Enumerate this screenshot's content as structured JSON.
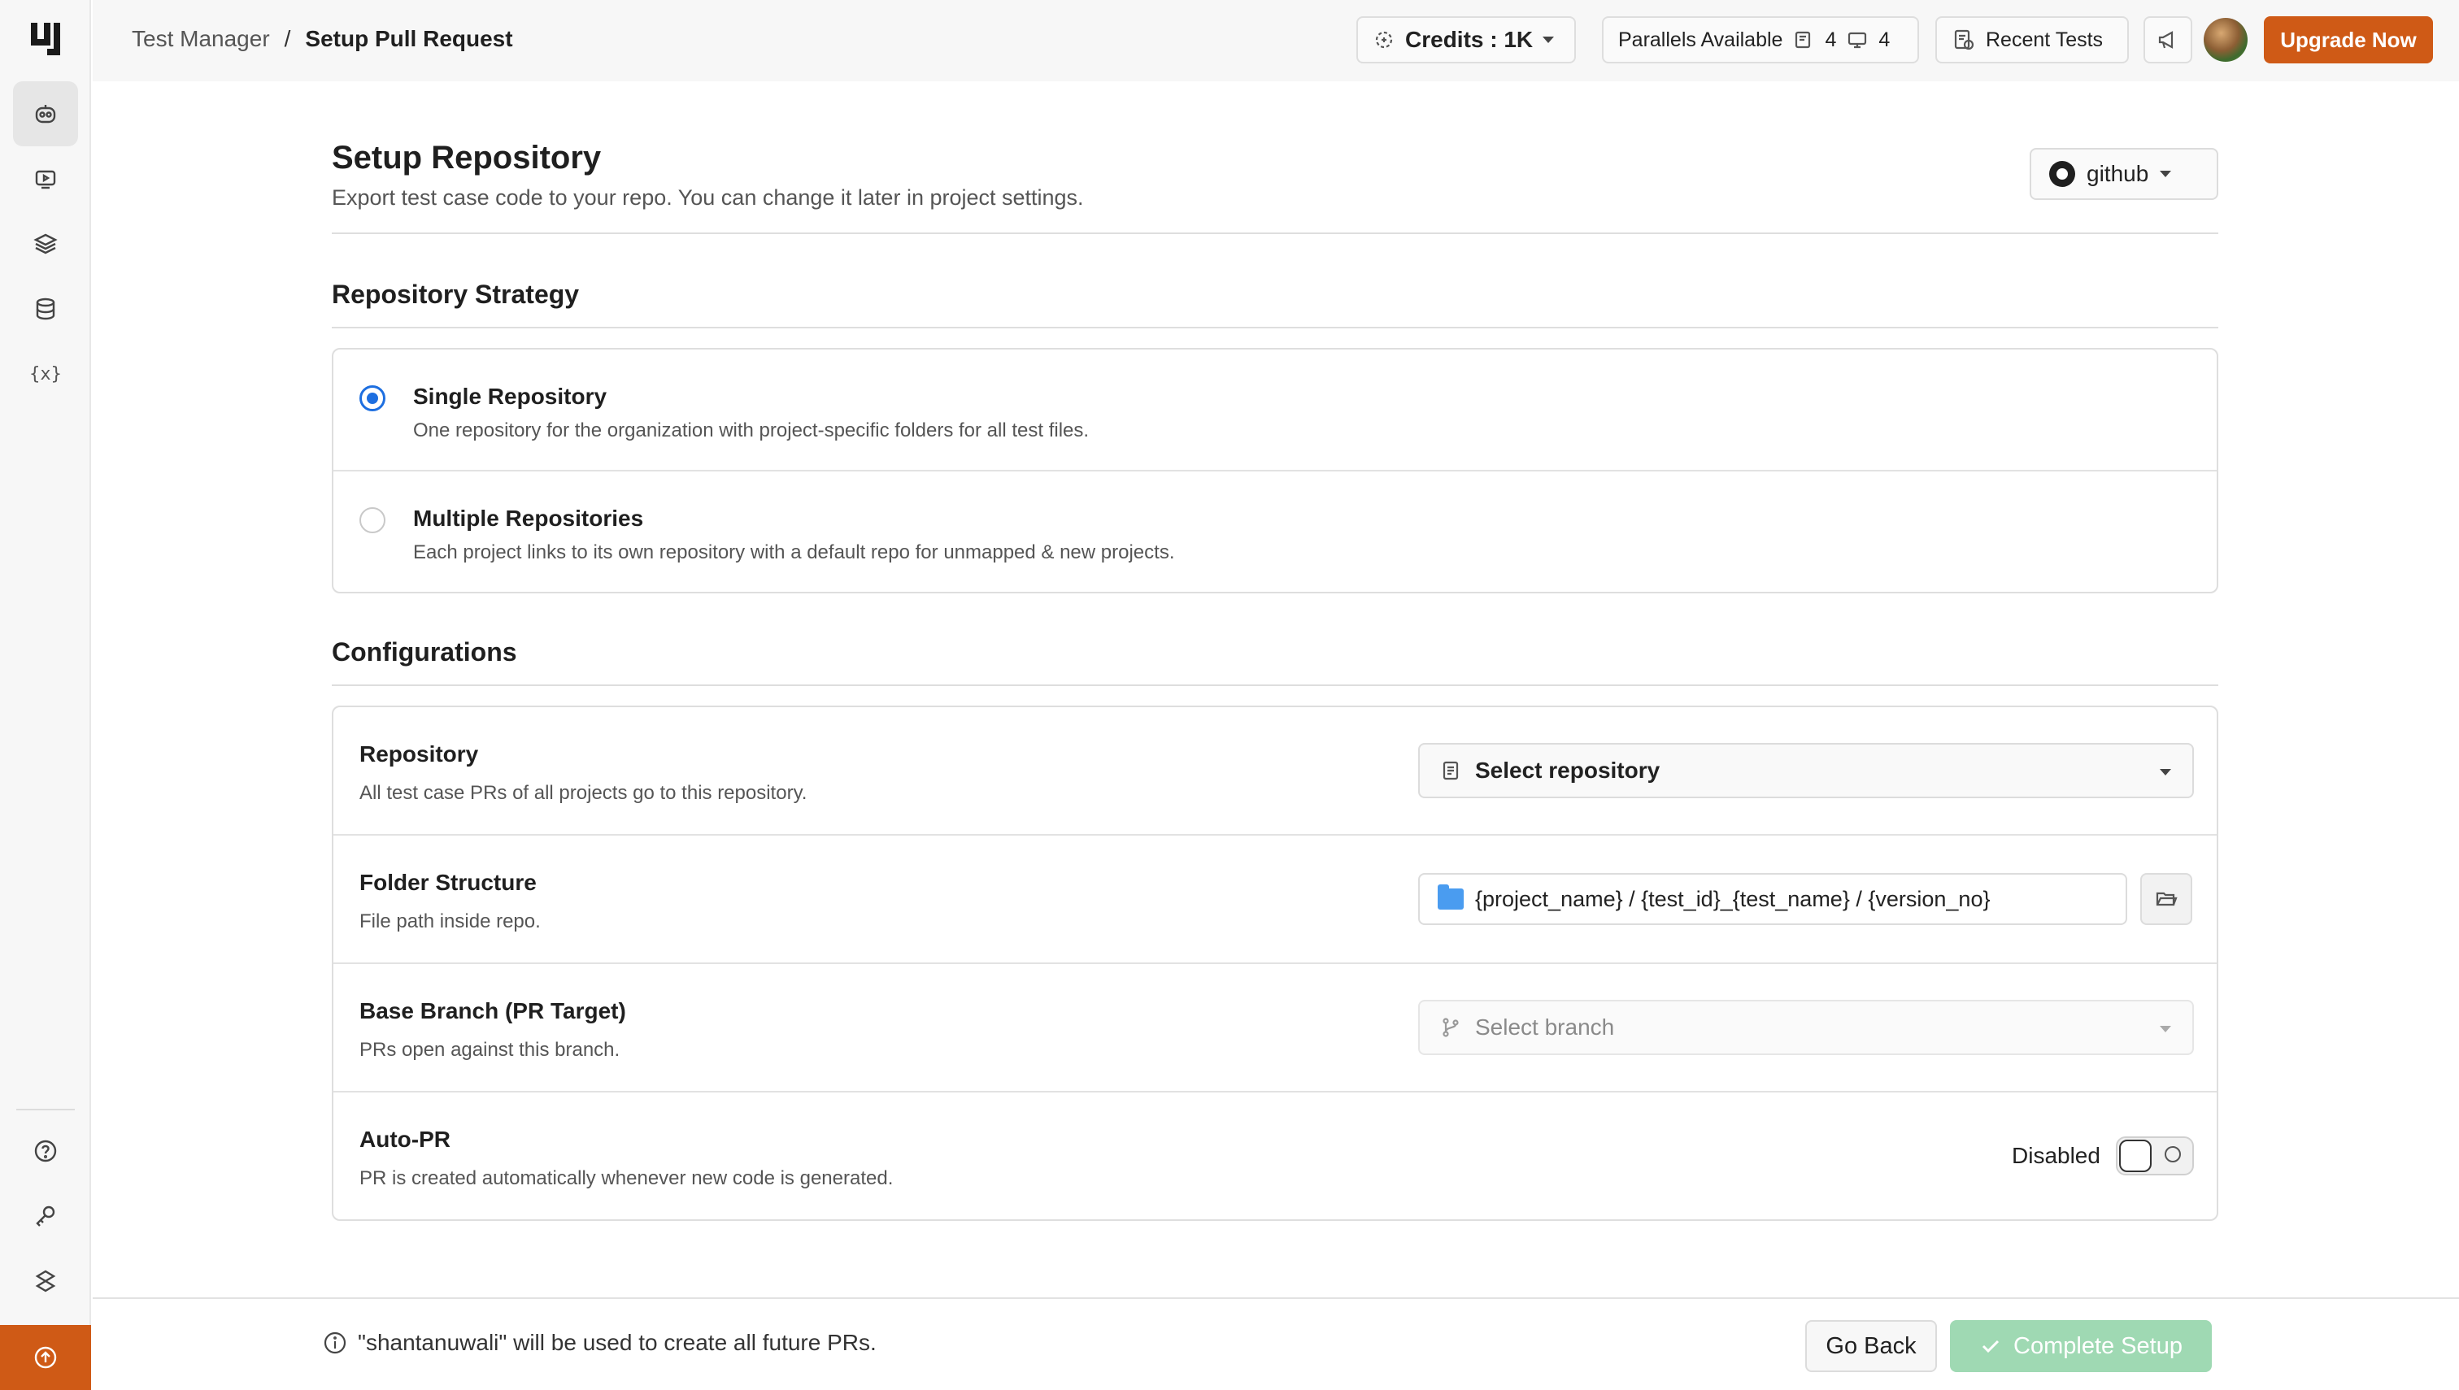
{
  "sidebar": {
    "logo": "logo-icon",
    "items": [
      {
        "name": "sidebar-item-test-manager",
        "icon": "robot-icon",
        "active": true
      },
      {
        "name": "sidebar-item-recordings",
        "icon": "video-icon",
        "active": false
      },
      {
        "name": "sidebar-item-layers",
        "icon": "layers-icon",
        "active": false
      },
      {
        "name": "sidebar-item-database",
        "icon": "database-icon",
        "active": false
      },
      {
        "name": "sidebar-item-variables",
        "icon": "variables-icon",
        "label": "{x}",
        "active": false
      }
    ],
    "bottom_items": [
      {
        "name": "sidebar-item-help",
        "icon": "help-icon"
      },
      {
        "name": "sidebar-item-keys",
        "icon": "key-icon"
      },
      {
        "name": "sidebar-item-integrations",
        "icon": "integration-icon"
      }
    ]
  },
  "header": {
    "breadcrumb": {
      "parent": "Test Manager",
      "separator": "/",
      "current": "Setup Pull Request"
    },
    "credits_label": "Credits : 1K",
    "parallels_label": "Parallels Available",
    "parallel_web": "4",
    "parallel_mobile": "4",
    "recent_tests_label": "Recent Tests",
    "upgrade_label": "Upgrade Now"
  },
  "page": {
    "title": "Setup Repository",
    "subtitle": "Export test case code to your repo. You can change it later in project settings.",
    "provider": "github"
  },
  "strategy": {
    "title": "Repository Strategy",
    "options": [
      {
        "title": "Single Repository",
        "description": "One repository for the organization with project-specific folders for all test files.",
        "selected": true
      },
      {
        "title": "Multiple Repositories",
        "description": "Each project links to its own repository with a default repo for unmapped & new projects.",
        "selected": false
      }
    ]
  },
  "configurations": {
    "title": "Configurations",
    "repository": {
      "title": "Repository",
      "description": "All test case PRs of all projects go to this repository.",
      "placeholder": "Select repository"
    },
    "folder": {
      "title": "Folder Structure",
      "description": "File path inside repo.",
      "value": "{project_name} / {test_id}_{test_name} / {version_no}"
    },
    "branch": {
      "title": "Base Branch (PR Target)",
      "description": "PRs open against this branch.",
      "placeholder": "Select branch"
    },
    "autopr": {
      "title": "Auto-PR",
      "description": "PR is created automatically whenever new code is generated.",
      "status": "Disabled"
    }
  },
  "footer": {
    "note": "\"shantanuwali\" will be used to create all future PRs.",
    "back_label": "Go Back",
    "complete_label": "Complete Setup"
  },
  "colors": {
    "accent": "#cf5a16",
    "radio_selected": "#1e6fe0",
    "complete_disabled": "#9fd9b3",
    "folder": "#4a9cf0"
  }
}
